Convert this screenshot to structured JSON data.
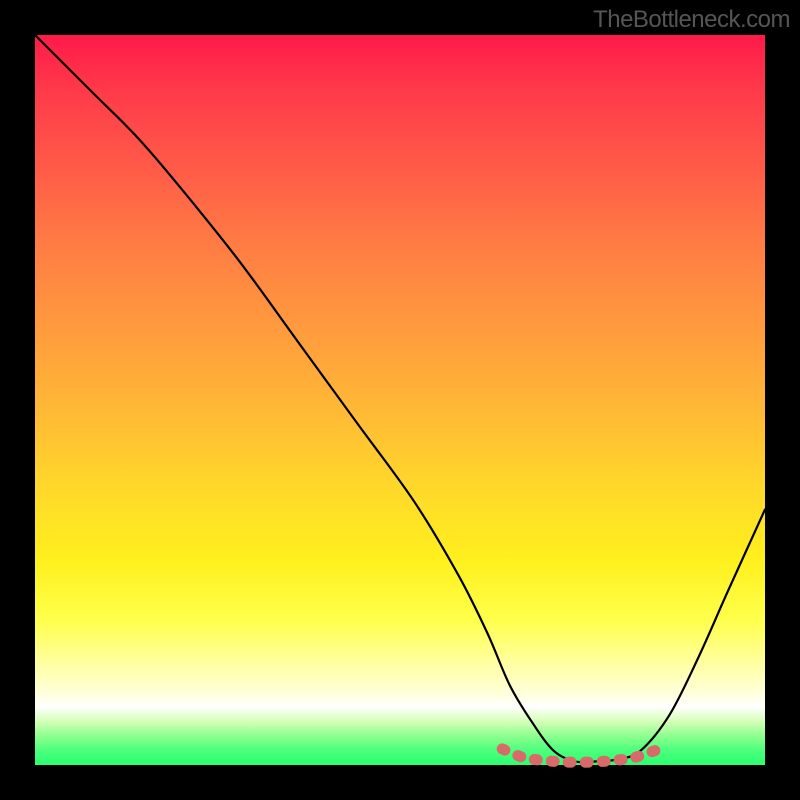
{
  "watermark": "TheBottleneck.com",
  "chart_data": {
    "type": "line",
    "title": "",
    "xlabel": "",
    "ylabel": "",
    "xlim": [
      0,
      100
    ],
    "ylim": [
      0,
      100
    ],
    "series": [
      {
        "name": "bottleneck-curve",
        "color": "#000000",
        "x": [
          0,
          4,
          8,
          14,
          20,
          28,
          36,
          44,
          52,
          58,
          62,
          65,
          68,
          71,
          74,
          77,
          80,
          83,
          87,
          91,
          95,
          100
        ],
        "y": [
          100,
          96,
          92,
          86,
          79,
          69,
          58,
          47,
          36,
          26,
          18,
          11,
          6,
          2,
          0.5,
          0.5,
          0.8,
          2,
          7,
          15,
          24,
          35
        ]
      },
      {
        "name": "optimal-range-marker",
        "color": "#e06666",
        "x": [
          64,
          67,
          70,
          73,
          76,
          79,
          82,
          85
        ],
        "y": [
          2.2,
          1.0,
          0.6,
          0.4,
          0.4,
          0.6,
          1.0,
          2.0
        ]
      }
    ],
    "grid": false,
    "legend": false
  }
}
